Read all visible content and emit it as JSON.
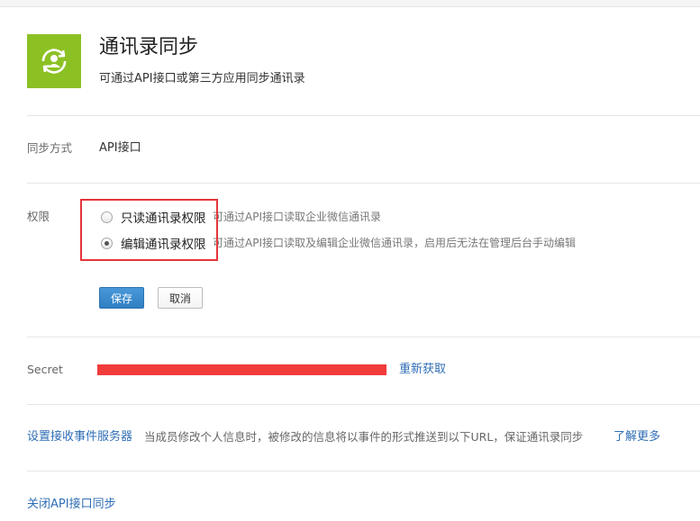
{
  "header": {
    "title": "通讯录同步",
    "subtitle": "可通过API接口或第三方应用同步通讯录",
    "icon": "contact-sync-icon",
    "icon_color": "#8cc124"
  },
  "sync_method": {
    "label": "同步方式",
    "value": "API接口"
  },
  "permission": {
    "label": "权限",
    "options": [
      {
        "label": "只读通讯录权限",
        "description": "可通过API接口读取企业微信通讯录",
        "checked": false
      },
      {
        "label": "编辑通讯录权限",
        "description": "可通过API接口读取及编辑企业微信通讯录，启用后无法在管理后台手动编辑",
        "checked": true
      }
    ],
    "highlight_color": "#e5353b"
  },
  "actions": {
    "save_label": "保存",
    "cancel_label": "取消"
  },
  "secret": {
    "label": "Secret",
    "redaction_color": "#f23b3b",
    "refresh_label": "重新获取"
  },
  "event_server": {
    "link_label": "设置接收事件服务器",
    "description": "当成员修改个人信息时，被修改的信息将以事件的形式推送到以下URL，保证通讯录同步",
    "learn_more_label": "了解更多"
  },
  "close_api": {
    "label": "关闭API接口同步"
  },
  "colors": {
    "link": "#2f6eb5",
    "primary_button": "#2f7fc4"
  }
}
